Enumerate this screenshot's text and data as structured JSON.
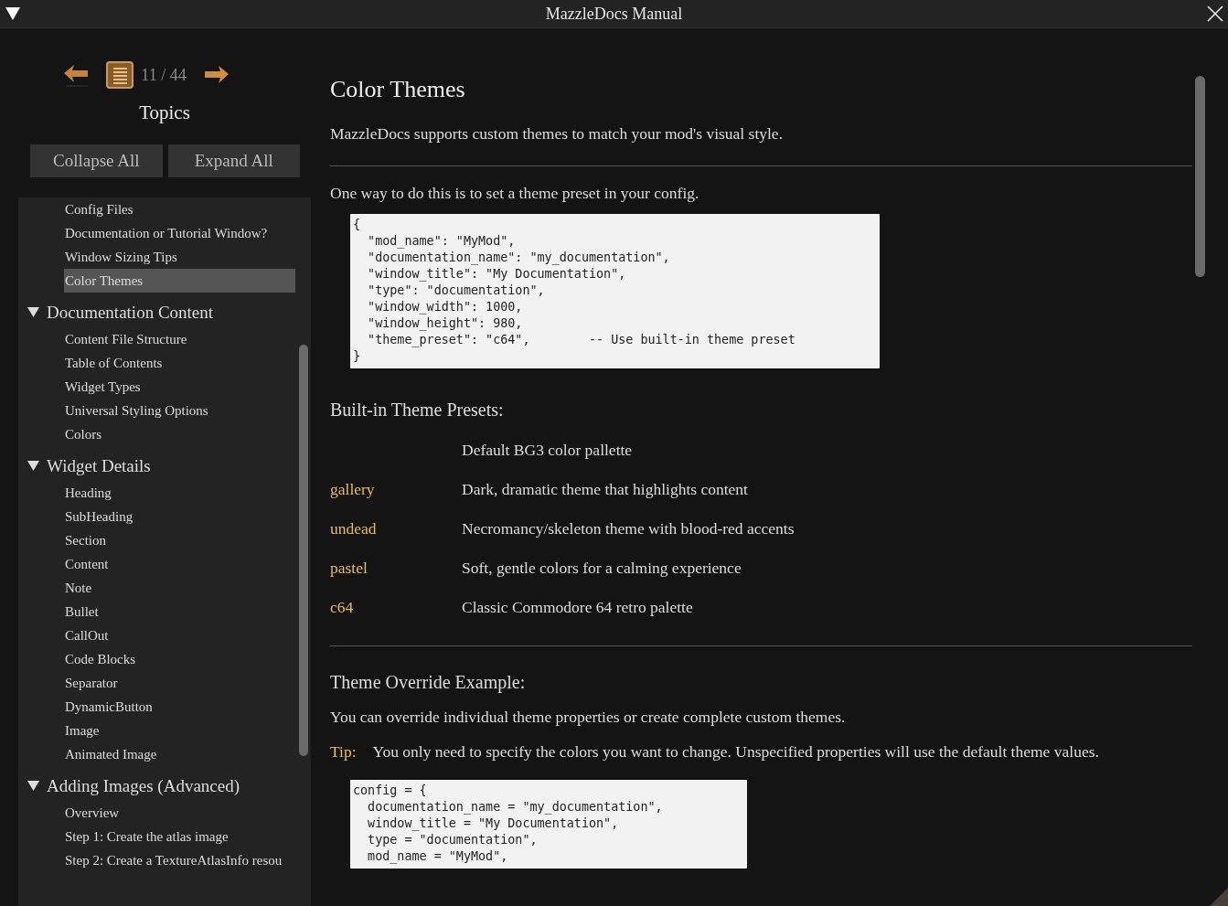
{
  "window": {
    "title": "MazzleDocs Manual"
  },
  "nav": {
    "page": "11 / 44"
  },
  "sidebar": {
    "title": "Topics",
    "buttons": [
      "Collapse All",
      "Expand All"
    ],
    "tree": [
      {
        "kind": "leaf",
        "label": "Config Files",
        "selected": false
      },
      {
        "kind": "leaf",
        "label": "Documentation or Tutorial Window?",
        "selected": false
      },
      {
        "kind": "leaf",
        "label": "Window Sizing Tips",
        "selected": false
      },
      {
        "kind": "leaf",
        "label": "Color Themes",
        "selected": true
      },
      {
        "kind": "group",
        "label": "Documentation Content",
        "expanded": true,
        "children": [
          {
            "label": "Content File Structure",
            "selected": false
          },
          {
            "label": "Table of Contents",
            "selected": false
          },
          {
            "label": "Widget Types",
            "selected": false
          },
          {
            "label": "Universal Styling Options",
            "selected": false
          },
          {
            "label": "Colors",
            "selected": false
          }
        ]
      },
      {
        "kind": "group",
        "label": "Widget Details",
        "expanded": true,
        "children": [
          {
            "label": "Heading",
            "selected": false
          },
          {
            "label": "SubHeading",
            "selected": false
          },
          {
            "label": "Section",
            "selected": false
          },
          {
            "label": "Content",
            "selected": false
          },
          {
            "label": "Note",
            "selected": false
          },
          {
            "label": "Bullet",
            "selected": false
          },
          {
            "label": "CallOut",
            "selected": false
          },
          {
            "label": "Code Blocks",
            "selected": false
          },
          {
            "label": "Separator",
            "selected": false
          },
          {
            "label": "DynamicButton",
            "selected": false
          },
          {
            "label": "Image",
            "selected": false
          },
          {
            "label": "Animated Image",
            "selected": false
          }
        ]
      },
      {
        "kind": "group",
        "label": "Adding Images (Advanced)",
        "expanded": true,
        "children": [
          {
            "label": "Overview",
            "selected": false
          },
          {
            "label": "Step 1: Create the atlas image",
            "selected": false
          },
          {
            "label": "Step 2: Create a TextureAtlasInfo resou",
            "selected": false
          }
        ]
      }
    ]
  },
  "content": {
    "blocks": [
      {
        "kind": "heading",
        "text": "Color Themes"
      },
      {
        "kind": "paragraph",
        "text": "MazzleDocs supports custom themes to match your mod's visual style."
      },
      {
        "kind": "separator"
      },
      {
        "kind": "paragraph",
        "text": "One way to do this is to set a theme preset in your config."
      },
      {
        "kind": "code",
        "lines": [
          "{",
          "  \"mod_name\": \"MyMod\",",
          "  \"documentation_name\": \"my_documentation\",",
          "  \"window_title\": \"My Documentation\",",
          "  \"type\": \"documentation\",",
          "  \"window_width\": 1000,",
          "  \"window_height\": 980,",
          "  \"theme_preset\": \"c64\",        -- Use built-in theme preset",
          "}"
        ]
      },
      {
        "kind": "subheading",
        "text": "Built-in Theme Presets:"
      },
      {
        "kind": "presets",
        "rows": [
          {
            "description": "Default BG3 color pallette"
          },
          {
            "name": "gallery",
            "description": "Dark, dramatic theme that highlights content"
          },
          {
            "name": "undead",
            "description": "Necromancy/skeleton theme with blood-red accents"
          },
          {
            "name": "pastel",
            "description": "Soft, gentle colors for a calming experience"
          },
          {
            "name": "c64",
            "description": "Classic Commodore 64 retro palette"
          }
        ]
      },
      {
        "kind": "separator"
      },
      {
        "kind": "subheading",
        "text": "Theme Override Example:"
      },
      {
        "kind": "paragraph",
        "text": "You can override individual theme properties or create complete custom themes."
      },
      {
        "kind": "tip",
        "label": "Tip:",
        "text": "You only need to specify the colors you want to change. Unspecified properties will use the default theme values."
      },
      {
        "kind": "code",
        "lines": [
          "config = {",
          "  documentation_name = \"my_documentation\",",
          "  window_title = \"My Documentation\",",
          "  type = \"documentation\",",
          "  mod_name = \"MyMod\","
        ]
      }
    ]
  }
}
